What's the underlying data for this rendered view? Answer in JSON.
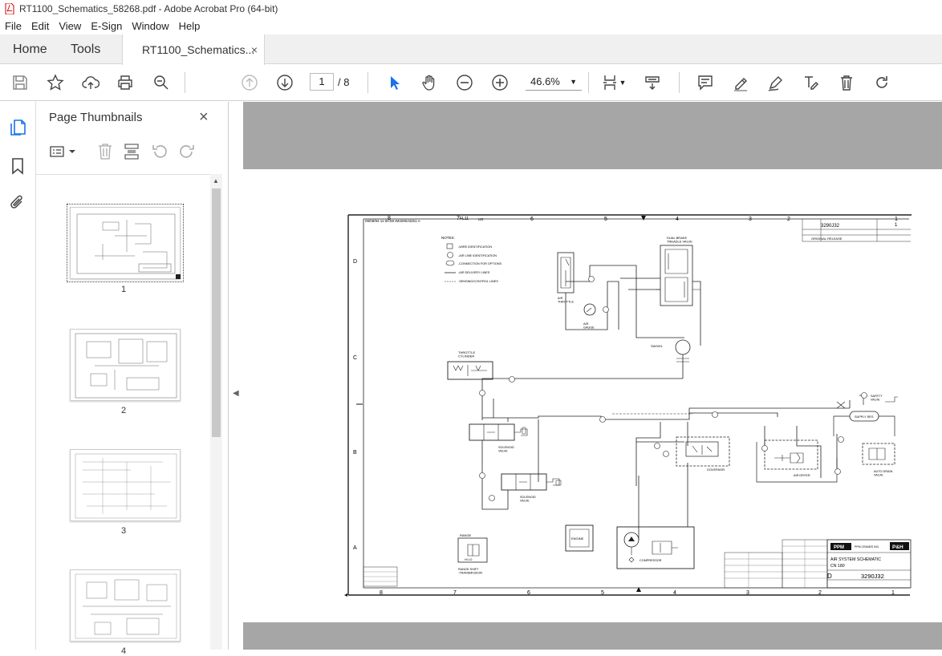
{
  "window": {
    "title": "RT1100_Schematics_58268.pdf - Adobe Acrobat Pro (64-bit)"
  },
  "menu": [
    "File",
    "Edit",
    "View",
    "E-Sign",
    "Window",
    "Help"
  ],
  "tabs": {
    "home": "Home",
    "tools": "Tools",
    "document": "RT1100_Schematics...",
    "close": "×"
  },
  "toolbar": {
    "current_page": "1",
    "total_pages": "/ 8",
    "zoom": "46.6%"
  },
  "panel": {
    "title": "Page Thumbnails",
    "close": "×"
  },
  "thumbnails": [
    {
      "label": "1",
      "selected": true
    },
    {
      "label": "2",
      "selected": false
    },
    {
      "label": "3",
      "selected": false
    },
    {
      "label": "4",
      "selected": false
    }
  ],
  "schematic": {
    "header_left": "09/08/94  11:00:59  IM3290J3251.A",
    "header_fl": "FL11",
    "header_us": "US",
    "zone_top": [
      "8",
      "7",
      "6",
      "5",
      "4",
      "3",
      "2",
      "1"
    ],
    "zone_bottom": [
      "8",
      "7",
      "6",
      "5",
      "4",
      "3",
      "2",
      "1"
    ],
    "zone_side": [
      "D",
      "C",
      "B",
      "A"
    ],
    "drawing_number": "3290J32",
    "sheet": "1",
    "revision_note": "ORIGINAL RELEASE",
    "notes_title": "NOTES:",
    "notes": [
      "-WIRE IDENTIFICATION",
      "-AIR LINE IDENTIFICATION",
      "-CONNECTION FOR OPTIONS",
      "-AIR DELIVERY LINES",
      "-SENSING/CONTROL LINES"
    ],
    "components": {
      "dual_brake": "DUAL BRAKE\nTREADLE VALVE",
      "air_throttle": "AIR\nTHROTTLE",
      "air_gauge": "AIR\nGAUGE",
      "swivel": "SWIVEL",
      "throttle_cylinder": "THROTTLE\nCYLINDER",
      "solenoid_valve_1": "SOLENOID\nVALVE",
      "solenoid_valve_2": "SOLENOID\nVALVE",
      "governor": "GOVERNOR",
      "air_dryer": "AIR DRYER",
      "supply_res": "SUPPLY RES",
      "safety_valve": "SAFETY\nVALVE",
      "auto_drain": "AUTO DRAIN\nVALVE",
      "engine": "ENGINE",
      "compressor": "COMPRESSOR",
      "range": "RANGE",
      "range_shift": "RANGE SHIFT\n-TRANSMISSION",
      "hi_lo": "HI  LO"
    },
    "title_block": {
      "company": "PPM CRANES INC.",
      "logo_left": "PPM",
      "logo_right": "P&H",
      "title": "AIR SYSTEM SCHEMATIC",
      "subtitle": "CN 180",
      "number": "3290J32",
      "size": "D"
    }
  },
  "colors": {
    "accent_blue": "#1a73e8",
    "viewer_bg": "#a6a6a6",
    "tab_bg": "#f0f0f0"
  }
}
